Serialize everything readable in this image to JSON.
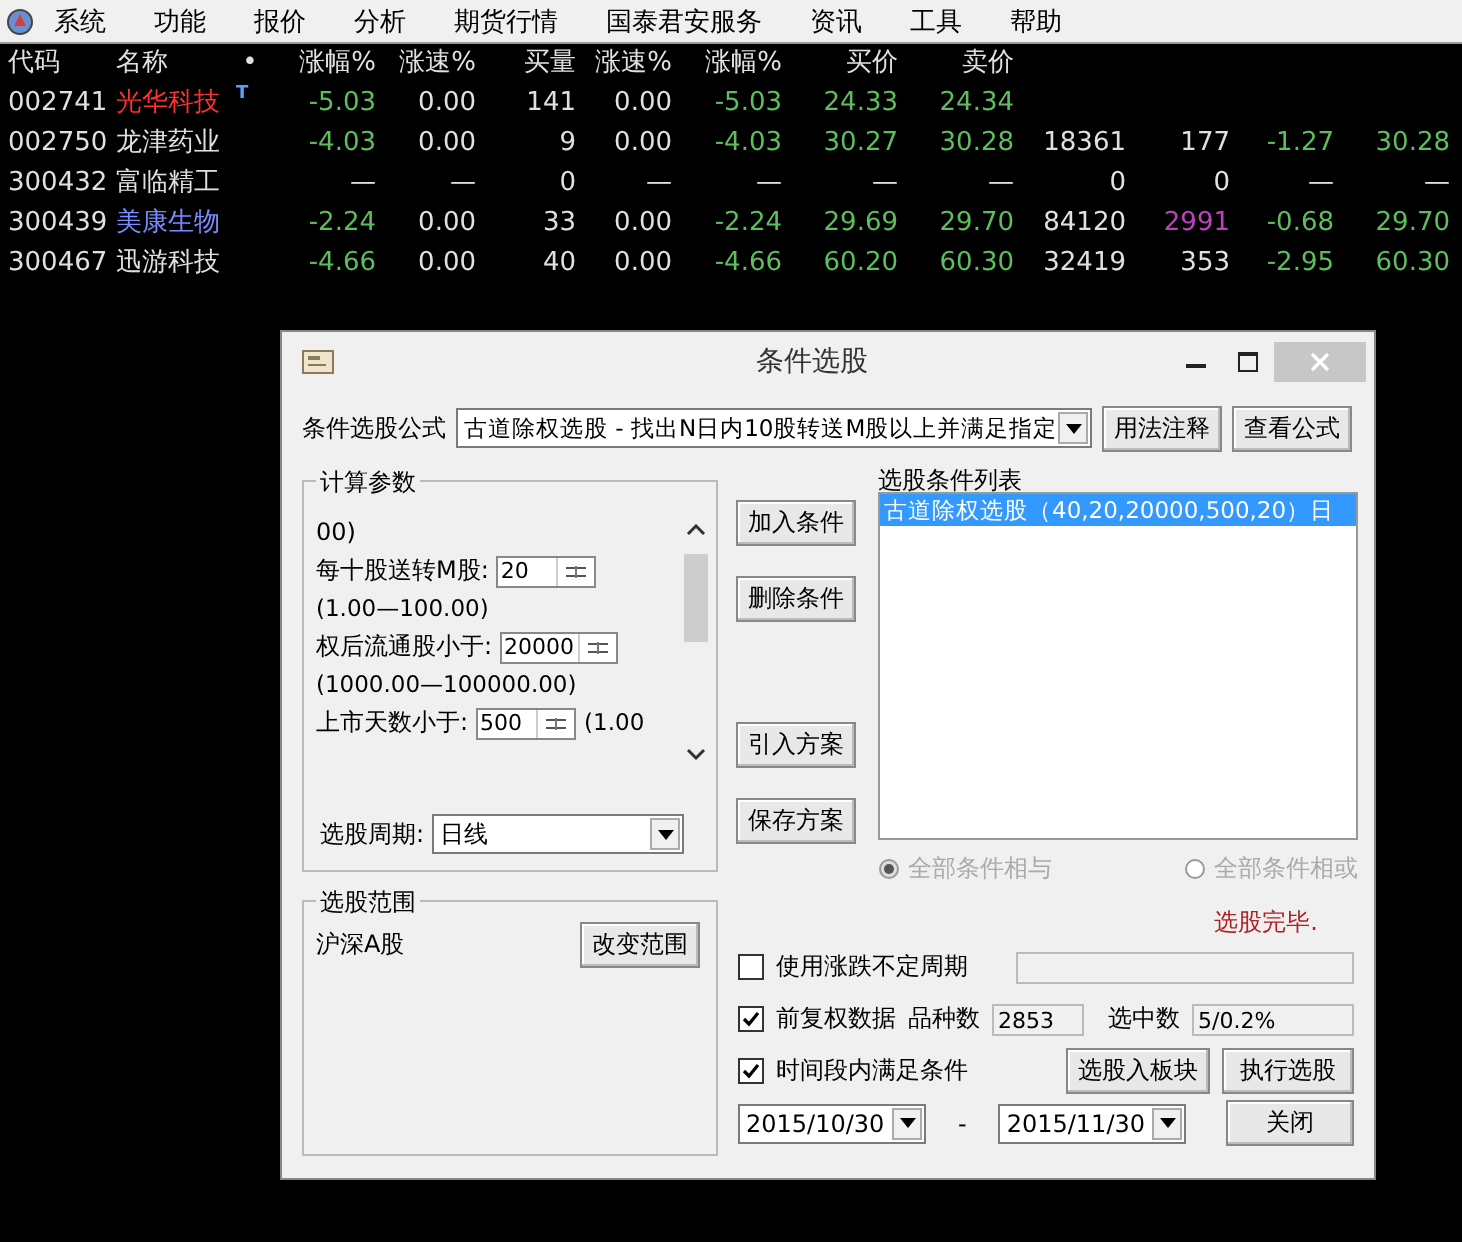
{
  "menu": [
    "系统",
    "功能",
    "报价",
    "分析",
    "期货行情",
    "国泰君安服务",
    "资讯",
    "工具",
    "帮助"
  ],
  "table": {
    "marker_header": "•",
    "columns": [
      "代码",
      "名称",
      "涨幅%",
      "涨速%",
      "买量",
      "涨速%",
      "涨幅%",
      "买价",
      "卖价"
    ],
    "rows": [
      {
        "cells": [
          {
            "text": "002741",
            "color": "#e0e0e0"
          },
          {
            "text": "光华科技",
            "color": "#ff3030"
          },
          {
            "text": "-5.03",
            "color": "#5cbf5c"
          },
          {
            "text": "0.00",
            "color": "#e0e0e0"
          },
          {
            "text": "141",
            "color": "#e0e0e0"
          },
          {
            "text": "0.00",
            "color": "#e0e0e0"
          },
          {
            "text": "-5.03",
            "color": "#5cbf5c"
          },
          {
            "text": "24.33",
            "color": "#5cbf5c"
          },
          {
            "text": "24.34",
            "color": "#5cbf5c"
          }
        ],
        "tag": "T"
      },
      {
        "cells": [
          {
            "text": "002750",
            "color": "#e0e0e0"
          },
          {
            "text": "龙津药业",
            "color": "#e0e0e0"
          },
          {
            "text": "-4.03",
            "color": "#5cbf5c"
          },
          {
            "text": "0.00",
            "color": "#e0e0e0"
          },
          {
            "text": "9",
            "color": "#e0e0e0"
          },
          {
            "text": "0.00",
            "color": "#e0e0e0"
          },
          {
            "text": "-4.03",
            "color": "#5cbf5c"
          },
          {
            "text": "30.27",
            "color": "#5cbf5c"
          },
          {
            "text": "30.28",
            "color": "#5cbf5c"
          },
          {
            "text": "18361",
            "color": "#e0e0e0"
          },
          {
            "text": "177",
            "color": "#e0e0e0"
          },
          {
            "text": "-1.27",
            "color": "#5cbf5c"
          },
          {
            "text": "30.28",
            "color": "#5cbf5c"
          }
        ]
      },
      {
        "cells": [
          {
            "text": "300432",
            "color": "#e0e0e0"
          },
          {
            "text": "富临精工",
            "color": "#e0e0e0"
          },
          {
            "text": "—",
            "color": "#e0e0e0"
          },
          {
            "text": "—",
            "color": "#e0e0e0"
          },
          {
            "text": "0",
            "color": "#e0e0e0"
          },
          {
            "text": "—",
            "color": "#e0e0e0"
          },
          {
            "text": "—",
            "color": "#e0e0e0"
          },
          {
            "text": "—",
            "color": "#e0e0e0"
          },
          {
            "text": "—",
            "color": "#e0e0e0"
          },
          {
            "text": "0",
            "color": "#e0e0e0"
          },
          {
            "text": "0",
            "color": "#e0e0e0"
          },
          {
            "text": "—",
            "color": "#e0e0e0"
          },
          {
            "text": "—",
            "color": "#e0e0e0"
          }
        ]
      },
      {
        "cells": [
          {
            "text": "300439",
            "color": "#e0e0e0"
          },
          {
            "text": "美康生物",
            "color": "#7a8cff"
          },
          {
            "text": "-2.24",
            "color": "#5cbf5c"
          },
          {
            "text": "0.00",
            "color": "#e0e0e0"
          },
          {
            "text": "33",
            "color": "#e0e0e0"
          },
          {
            "text": "0.00",
            "color": "#e0e0e0"
          },
          {
            "text": "-2.24",
            "color": "#5cbf5c"
          },
          {
            "text": "29.69",
            "color": "#5cbf5c"
          },
          {
            "text": "29.70",
            "color": "#5cbf5c"
          },
          {
            "text": "84120",
            "color": "#e0e0e0"
          },
          {
            "text": "2991",
            "color": "#c040c0"
          },
          {
            "text": "-0.68",
            "color": "#5cbf5c"
          },
          {
            "text": "29.70",
            "color": "#5cbf5c"
          }
        ]
      },
      {
        "cells": [
          {
            "text": "300467",
            "color": "#e0e0e0"
          },
          {
            "text": "迅游科技",
            "color": "#e0e0e0"
          },
          {
            "text": "-4.66",
            "color": "#5cbf5c"
          },
          {
            "text": "0.00",
            "color": "#e0e0e0"
          },
          {
            "text": "40",
            "color": "#e0e0e0"
          },
          {
            "text": "0.00",
            "color": "#e0e0e0"
          },
          {
            "text": "-4.66",
            "color": "#5cbf5c"
          },
          {
            "text": "60.20",
            "color": "#5cbf5c"
          },
          {
            "text": "60.30",
            "color": "#5cbf5c"
          },
          {
            "text": "32419",
            "color": "#e0e0e0"
          },
          {
            "text": "353",
            "color": "#e0e0e0"
          },
          {
            "text": "-2.95",
            "color": "#5cbf5c"
          },
          {
            "text": "60.30",
            "color": "#5cbf5c"
          }
        ]
      }
    ]
  },
  "dialog": {
    "title": "条件选股",
    "formula_label": "条件选股公式",
    "formula_value": "古道除权选股 - 找出N日内10股转送M股以上并满足指定",
    "formula_buttons": [
      "用法注释",
      "查看公式"
    ],
    "params_group": "计算参数",
    "params_lead": "00)",
    "params": [
      {
        "label": "每十股送转M股:",
        "value": "20",
        "range": "(1.00—100.00)"
      },
      {
        "label": "权后流通股小于:",
        "value": "20000",
        "range": "(1000.00—100000.00)"
      },
      {
        "label": "上市天数小于:",
        "value": "500",
        "range": "(1.00"
      }
    ],
    "period_label": "选股周期:",
    "period_value": "日线",
    "scope_group": "选股范围",
    "scope_value": "沪深A股",
    "scope_button": "改变范围",
    "middle_buttons": [
      "加入条件",
      "删除条件",
      "引入方案",
      "保存方案"
    ],
    "list_label": "选股条件列表",
    "list_items": [
      {
        "text": "古道除权选股（40,20,20000,500,20）日",
        "selected": true
      }
    ],
    "radios": [
      {
        "label": "全部条件相与",
        "selected": true,
        "disabled": true
      },
      {
        "label": "全部条件相或",
        "selected": false,
        "disabled": true
      }
    ],
    "status": "选股完毕.",
    "options": [
      {
        "label": "使用涨跌不定周期",
        "checked": false
      },
      {
        "label": "前复权数据",
        "checked": true
      },
      {
        "label": "时间段内满足条件",
        "checked": true
      }
    ],
    "count_label": "品种数",
    "count_value": "2853",
    "selected_label": "选中数",
    "selected_value": "5/0.2%",
    "block_button": "选股入板块",
    "run_button": "执行选股",
    "close_button": "关闭",
    "date_from": "2015/10/30",
    "date_sep": "-",
    "date_to": "2015/11/30"
  }
}
